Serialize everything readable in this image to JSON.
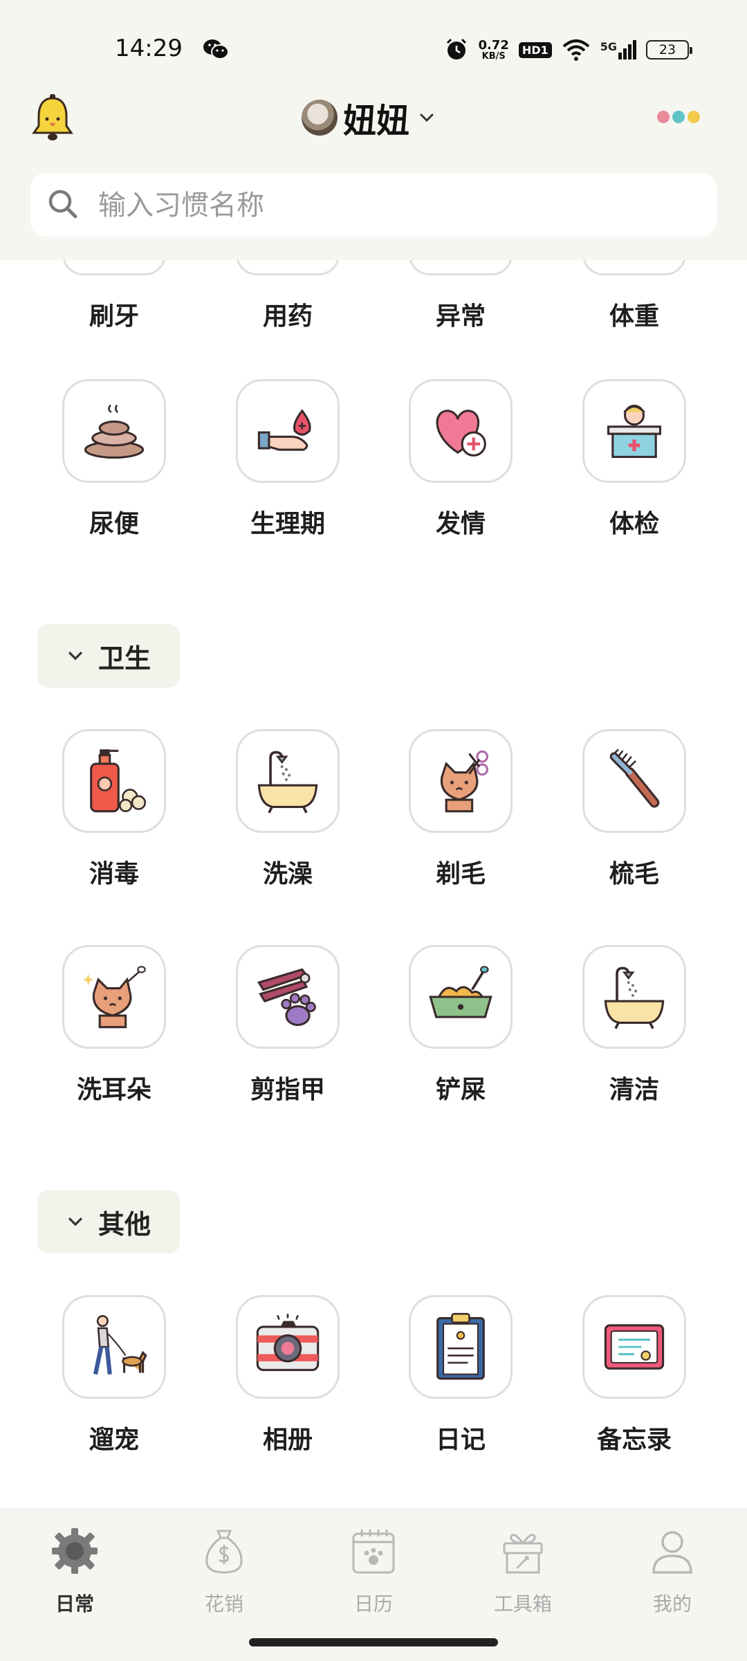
{
  "status": {
    "time": "14:29",
    "net_speed": "0.72",
    "net_unit": "KB/S",
    "hd_label": "HD1",
    "signal_label": "5G",
    "battery": "23"
  },
  "header": {
    "pet_name": "妞妞",
    "search_placeholder": "输入习惯名称"
  },
  "health": {
    "items_partial": [
      "刷牙",
      "用药",
      "异常",
      "体重"
    ],
    "items": [
      "尿便",
      "生理期",
      "发情",
      "体检"
    ]
  },
  "hygiene": {
    "title": "卫生",
    "items": [
      "消毒",
      "洗澡",
      "剃毛",
      "梳毛",
      "洗耳朵",
      "剪指甲",
      "铲屎",
      "清洁"
    ]
  },
  "other": {
    "title": "其他",
    "items": [
      "遛宠",
      "相册",
      "日记",
      "备忘录"
    ]
  },
  "tabs": [
    {
      "label": "日常",
      "icon": "gear-icon",
      "active": true
    },
    {
      "label": "花销",
      "icon": "money-bag-icon"
    },
    {
      "label": "日历",
      "icon": "calendar-icon"
    },
    {
      "label": "工具箱",
      "icon": "gift-box-icon"
    },
    {
      "label": "我的",
      "icon": "person-icon"
    }
  ],
  "colors": {
    "accent_red": "#e88a9a",
    "accent_teal": "#5fc4c8",
    "accent_yellow": "#f2c94c",
    "bg_header": "#f6f6f1"
  }
}
